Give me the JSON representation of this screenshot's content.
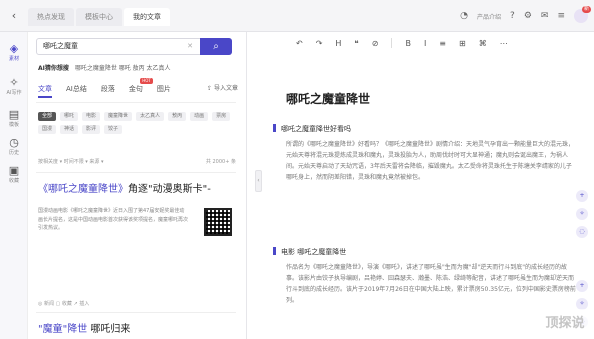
{
  "window": {
    "tabs": [
      {
        "label": "热点发现",
        "active": false
      },
      {
        "label": "模板中心",
        "active": false
      },
      {
        "label": "我的文章",
        "active": true
      }
    ]
  },
  "topbar": {
    "right_items": [
      "产品介绍",
      "帮助",
      "设置",
      "反馈"
    ],
    "avatar_badge": "新"
  },
  "rail": [
    {
      "icon": "layers-icon",
      "glyph": "◈",
      "label": "素材",
      "active": true
    },
    {
      "icon": "ai-icon",
      "glyph": "✧",
      "label": "AI写作",
      "active": false
    },
    {
      "icon": "doc-icon",
      "glyph": "▤",
      "label": "模板",
      "active": false
    },
    {
      "icon": "clock-icon",
      "glyph": "◷",
      "label": "历史",
      "active": false
    },
    {
      "icon": "archive-icon",
      "glyph": "▣",
      "label": "收藏",
      "active": false
    }
  ],
  "search": {
    "value": "哪吒之魔童",
    "button_glyph": "⌕"
  },
  "ai_row": {
    "label": "AI猜你想搜",
    "items": "哪吒之魔童降世  哪吒  敖丙  太乙真人"
  },
  "subtabs": [
    {
      "label": "文章",
      "active": true
    },
    {
      "label": "AI总结",
      "active": false
    },
    {
      "label": "段落",
      "active": false
    },
    {
      "label": "金句",
      "active": false,
      "hot": "HOT"
    },
    {
      "label": "图片",
      "active": false
    }
  ],
  "import_label": "导入文章",
  "chips": [
    "全部",
    "哪吒",
    "电影",
    "魔童降世",
    "太乙真人",
    "敖丙",
    "动画",
    "票房",
    "国漫",
    "神话",
    "影评",
    "饺子"
  ],
  "filter": {
    "left": "按相关度 ▾   时间不限 ▾   来源 ▾",
    "right": "共 2000+ 条"
  },
  "results": [
    {
      "title_hl": "《哪吒之魔童降世》",
      "title_rest": "角逐\"动漫奥斯卡\"-",
      "snippet": "国漫动画电影《哪吒之魔童降世》近日入围了第47届安妮奖最佳动画长片提名，这是中国动画电影首次获得该奖项提名，魔童哪吒再次引发热议。",
      "meta": "◎ 新闻    ▢ 收藏    ↗ 插入"
    },
    {
      "title_hl": "\"魔童\"降世",
      "title_rest": "  哪吒归来",
      "snippet": "",
      "meta": ""
    }
  ],
  "toolbar": [
    "↶",
    "↷",
    "H",
    "❝",
    "⊘",
    "B",
    "I",
    "≡",
    "⊞",
    "⌘",
    "⋯"
  ],
  "doc": {
    "title": "哪吒之魔童降世",
    "sections": [
      {
        "head": "哪吒之魔童降世好看吗",
        "text": "所谓的《哪吒之魔童降世》好看吗？《哪吒之魔童降世》剧情介绍：天地灵气孕育出一颗能量巨大的混元珠，元始天尊将混元珠提炼成灵珠和魔丸，灵珠投胎为人，助周伐纣时可大显神通；魔丸则会诞出魔王，为祸人间。元始天尊启动了天劫咒语，3年后天雷将会降临，摧毁魔丸。太乙受命将灵珠托生于陈塘关李靖家的儿子哪吒身上，然而阴差阳错，灵珠和魔丸竟然被掉包。"
      },
      {
        "head": "电影 哪吒之魔童降世",
        "text": "作品名为《哪吒之魔童降世》，导演《哪吒》，讲述了哪吒虽\"生而为魔\"却\"逆天而行斗到底\"的成长经历的故事。该影片由饺子执导编剧，吕艳婷、囧森瑟夫、瀚墨、陈浩、绿绮等配音，讲述了哪吒虽生而为魔却逆天而行斗到底的成长经历。该片于2019年7月26日在中国大陆上映，累计票房50.35亿元，位列中国影史票房榜前列。"
      }
    ]
  },
  "watermark": "顶探说"
}
